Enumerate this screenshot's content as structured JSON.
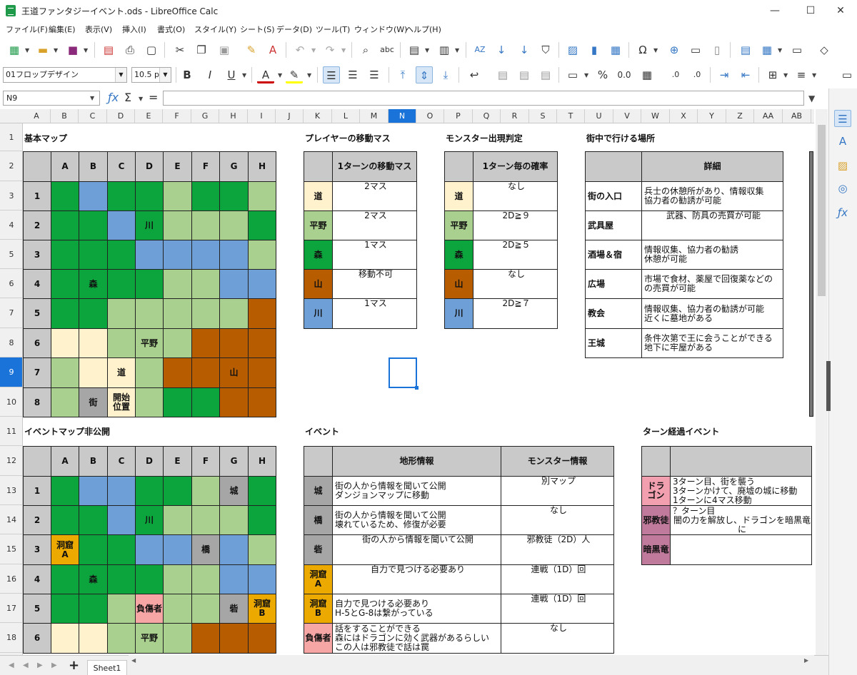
{
  "window": {
    "title": "王道ファンタジーイベント.ods - LibreOffice Calc",
    "min": "—",
    "max": "☐",
    "close": "✕"
  },
  "menu": [
    "ファイル(F)",
    "編集(E)",
    "表示(V)",
    "挿入(I)",
    "書式(O)",
    "スタイル(Y)",
    "シート(S)",
    "データ(D)",
    "ツール(T)",
    "ウィンドウ(W)",
    "ヘルプ(H)"
  ],
  "toolbar2": {
    "font_name": "01フロップデザイン",
    "font_size": "10.5 pt"
  },
  "formula": {
    "cell_ref": "N9",
    "value": ""
  },
  "columns": [
    "A",
    "B",
    "C",
    "D",
    "E",
    "F",
    "G",
    "H",
    "I",
    "J",
    "K",
    "L",
    "M",
    "N",
    "O",
    "P",
    "Q",
    "R",
    "S",
    "T",
    "U",
    "V",
    "W",
    "X",
    "Y",
    "Z",
    "AA",
    "AB"
  ],
  "rows": [
    "1",
    "2",
    "3",
    "4",
    "5",
    "6",
    "7",
    "8",
    "9",
    "10",
    "11",
    "12",
    "13",
    "14",
    "15",
    "16",
    "17",
    "18"
  ],
  "active": {
    "col": "N",
    "row": "9"
  },
  "colors": {
    "forest": "#0ca43d",
    "plain": "#a9d08e",
    "road": "#fff2cc",
    "mountain": "#b75d00",
    "river": "#6f9fd7",
    "town": "#a6a6a6",
    "header": "#c9c9c9",
    "cave": "#ecaa00",
    "injured": "#f7a6a6",
    "dragon": "#f2a0b0",
    "cult": "#c07a9c",
    "blackdragon": "#c07a9c"
  },
  "section_titles": {
    "basic_map": "基本マップ",
    "player_move": "プレイヤーの移動マス",
    "monster_appear": "モンスター出現判定",
    "town_places": "街中で行ける場所",
    "event_map": "イベントマップ非公開",
    "events": "イベント",
    "turn_events": "ターン経過イベント"
  },
  "map_cols": [
    "A",
    "B",
    "C",
    "D",
    "E",
    "F",
    "G",
    "H"
  ],
  "map_rows": [
    "1",
    "2",
    "3",
    "4",
    "5",
    "6",
    "7",
    "8"
  ],
  "basic_map": {
    "grid": [
      [
        "F",
        "R",
        "F",
        "F",
        "P",
        "F",
        "F",
        "P"
      ],
      [
        "F",
        "F",
        "R",
        "F",
        "P",
        "P",
        "P",
        "F"
      ],
      [
        "F",
        "F",
        "F",
        "R",
        "R",
        "R",
        "R",
        "P"
      ],
      [
        "F",
        "F",
        "F",
        "F",
        "P",
        "P",
        "R",
        "R"
      ],
      [
        "F",
        "F",
        "P",
        "P",
        "P",
        "P",
        "P",
        "M"
      ],
      [
        "Y",
        "Y",
        "P",
        "P",
        "P",
        "M",
        "M",
        "M"
      ],
      [
        "P",
        "Y",
        "Y",
        "P",
        "M",
        "M",
        "M",
        "M"
      ],
      [
        "P",
        "T",
        "Y",
        "P",
        "F",
        "F",
        "M",
        "M"
      ]
    ],
    "labels": [
      {
        "r": 1,
        "c": 3,
        "t": "川"
      },
      {
        "r": 3,
        "c": 1,
        "t": "森"
      },
      {
        "r": 5,
        "c": 3,
        "t": "平野"
      },
      {
        "r": 6,
        "c": 2,
        "t": "道"
      },
      {
        "r": 6,
        "c": 6,
        "t": "山"
      },
      {
        "r": 7,
        "c": 1,
        "t": "街"
      },
      {
        "r": 7,
        "c": 2,
        "t": "開始\n位置"
      }
    ]
  },
  "event_map": {
    "grid": [
      [
        "F",
        "R",
        "R",
        "F",
        "F",
        "P",
        "T",
        "F"
      ],
      [
        "F",
        "F",
        "R",
        "F",
        "P",
        "P",
        "P",
        "F"
      ],
      [
        "C",
        "F",
        "F",
        "R",
        "R",
        "X",
        "R",
        "P"
      ],
      [
        "F",
        "F",
        "F",
        "F",
        "P",
        "P",
        "R",
        "R"
      ],
      [
        "F",
        "F",
        "P",
        "I",
        "P",
        "P",
        "T",
        "C"
      ],
      [
        "Y",
        "Y",
        "P",
        "P",
        "P",
        "M",
        "M",
        "M"
      ]
    ],
    "labels": [
      {
        "r": 0,
        "c": 6,
        "t": "城"
      },
      {
        "r": 1,
        "c": 3,
        "t": "川"
      },
      {
        "r": 2,
        "c": 0,
        "t": "洞窟\nA"
      },
      {
        "r": 2,
        "c": 5,
        "t": "橋"
      },
      {
        "r": 3,
        "c": 1,
        "t": "森"
      },
      {
        "r": 4,
        "c": 3,
        "t": "負傷者"
      },
      {
        "r": 4,
        "c": 6,
        "t": "砦"
      },
      {
        "r": 4,
        "c": 7,
        "t": "洞窟\nB"
      },
      {
        "r": 5,
        "c": 3,
        "t": "平野"
      }
    ]
  },
  "move_table": {
    "header": "1ターンの移動マス",
    "rows": [
      {
        "k": "道",
        "v": "2マス",
        "c": "road"
      },
      {
        "k": "平野",
        "v": "2マス",
        "c": "plain"
      },
      {
        "k": "森",
        "v": "1マス",
        "c": "forest"
      },
      {
        "k": "山",
        "v": "移動不可",
        "c": "mountain"
      },
      {
        "k": "川",
        "v": "1マス",
        "c": "river"
      }
    ]
  },
  "monster_table": {
    "header": "1ターン毎の確率",
    "rows": [
      {
        "k": "道",
        "v": "なし",
        "c": "road"
      },
      {
        "k": "平野",
        "v": "2D≧９",
        "c": "plain"
      },
      {
        "k": "森",
        "v": "2D≧５",
        "c": "forest"
      },
      {
        "k": "山",
        "v": "なし",
        "c": "mountain"
      },
      {
        "k": "川",
        "v": "2D≧７",
        "c": "river"
      }
    ]
  },
  "town_table": {
    "header": "詳細",
    "rows": [
      {
        "k": "街の入口",
        "v": "兵士の休憩所があり、情報収集\n協力者の勧誘が可能"
      },
      {
        "k": "武具屋",
        "v": "武器、防具の売買が可能"
      },
      {
        "k": "酒場＆宿",
        "v": "情報収集、協力者の勧誘\n休憩が可能"
      },
      {
        "k": "広場",
        "v": "市場で食材、薬屋で回復薬などの\nの売買が可能"
      },
      {
        "k": "教会",
        "v": "情報収集、協力者の勧誘が可能\n近くに墓地がある"
      },
      {
        "k": "王城",
        "v": "条件次第で王に会うことができる\n地下に牢屋がある"
      }
    ]
  },
  "event_table": {
    "h1": "地形情報",
    "h2": "モンスター情報",
    "rows": [
      {
        "k": "城",
        "c": "town",
        "a": "街の人から情報を聞いて公開\nダンジョンマップに移動",
        "b": "別マップ"
      },
      {
        "k": "橋",
        "c": "town",
        "x": true,
        "a": "街の人から情報を聞いて公開\n壊れているため、修復が必要",
        "b": "なし"
      },
      {
        "k": "砦",
        "c": "town",
        "a": "街の人から情報を聞いて公開",
        "b": "邪教徒（2D）人"
      },
      {
        "k": "洞窟\nA",
        "c": "cave",
        "a": "自力で見つける必要あり",
        "b": "連戦（1D）回"
      },
      {
        "k": "洞窟\nB",
        "c": "cave",
        "a": "自力で見つける必要あり\nH-5とG-8は繋がっている",
        "b": "連戦（1D）回"
      },
      {
        "k": "負傷者",
        "c": "injured",
        "a": "話をすることができる\n森にはドラゴンに効く武器があるらしい\nこの人は邪教徒で話は罠",
        "b": "なし"
      }
    ]
  },
  "turn_table": {
    "rows": [
      {
        "k": "ドラ\nゴン",
        "c": "dragon",
        "v": "3ターン目、街を襲う\n3ターンかけて、廃墟の城に移動\n1ターンに4マス移動"
      },
      {
        "k": "邪教徒",
        "c": "cult",
        "v": "？ターン目\n闇の力を解放し、ドラゴンを暗黒竜に"
      },
      {
        "k": "暗黒竜",
        "c": "blackdragon",
        "v": ""
      }
    ]
  },
  "sheet_tab": "Sheet1"
}
